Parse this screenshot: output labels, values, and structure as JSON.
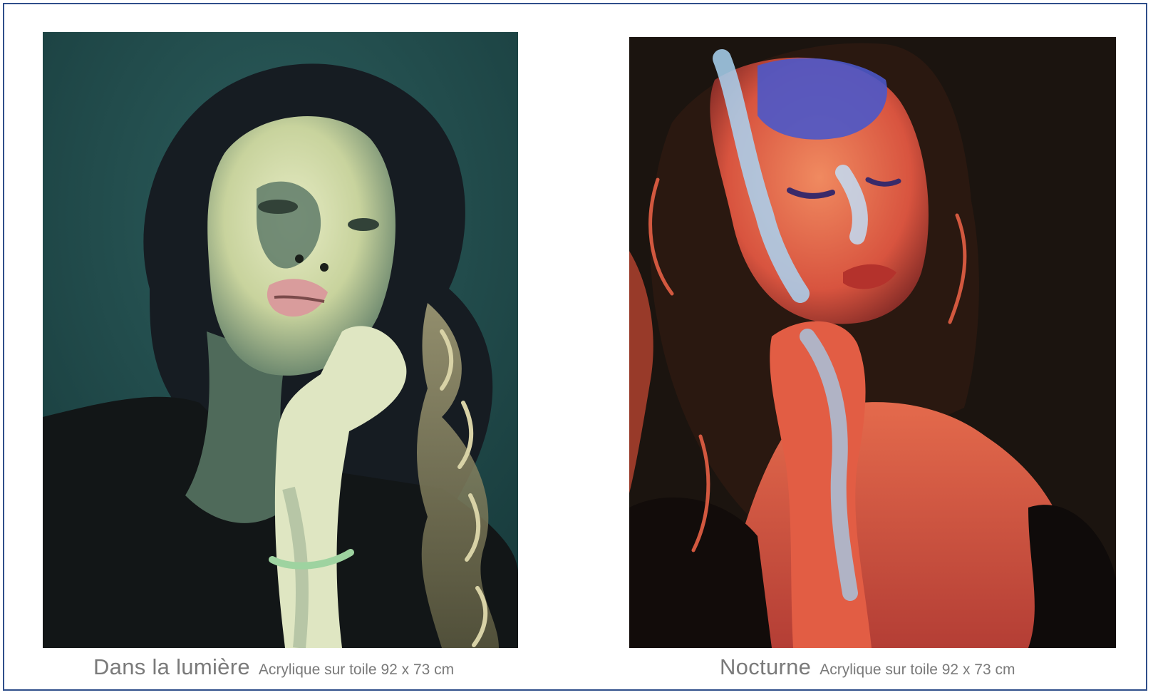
{
  "artworks": [
    {
      "title": "Dans la lumière",
      "details": "Acrylique sur toile 92 x 73 cm",
      "palette": {
        "background": "#1f4747",
        "skin": "#d9dfb0",
        "shadow": "#3c5a52",
        "hair": "#1a1f24",
        "lips": "#d89a9a"
      }
    },
    {
      "title": "Nocturne",
      "details": "Acrylique sur toile 92 x 73 cm",
      "palette": {
        "background": "#1a140f",
        "skin": "#e0664a",
        "light": "#8fc6ee",
        "accent": "#4a56c8",
        "hair": "#24160f"
      }
    }
  ]
}
